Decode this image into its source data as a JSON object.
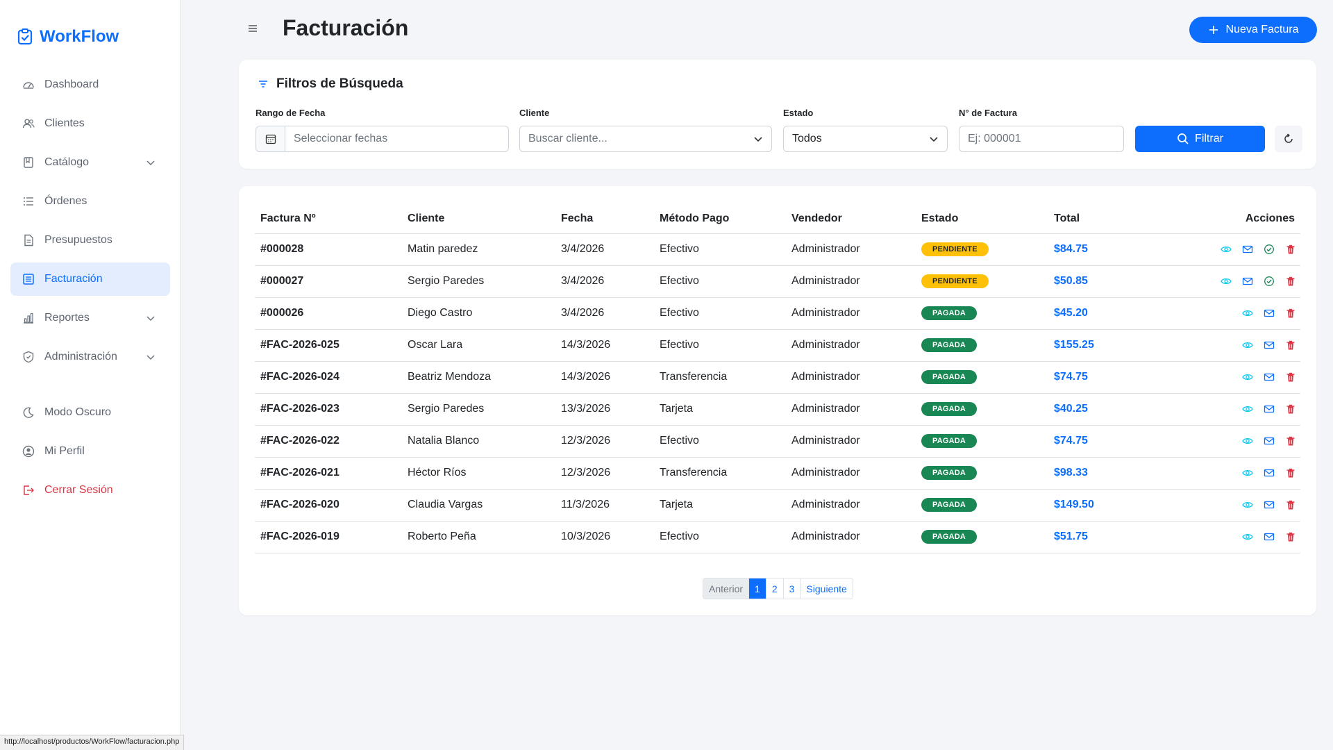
{
  "app": {
    "brand": "WorkFlow",
    "brand_color": "#0d6efd"
  },
  "sidebar": {
    "items": [
      {
        "label": "Dashboard",
        "icon": "dashboard-icon"
      },
      {
        "label": "Clientes",
        "icon": "users-icon"
      },
      {
        "label": "Catálogo",
        "icon": "catalog-icon",
        "has_submenu": true
      },
      {
        "label": "Órdenes",
        "icon": "list-icon"
      },
      {
        "label": "Presupuestos",
        "icon": "document-icon"
      },
      {
        "label": "Facturación",
        "icon": "invoice-icon",
        "active": true
      },
      {
        "label": "Reportes",
        "icon": "chart-icon",
        "has_submenu": true
      },
      {
        "label": "Administración",
        "icon": "shield-icon",
        "has_submenu": true
      }
    ],
    "secondary": [
      {
        "label": "Modo Oscuro",
        "icon": "moon-icon"
      },
      {
        "label": "Mi Perfil",
        "icon": "user-circle-icon"
      },
      {
        "label": "Cerrar Sesión",
        "icon": "logout-icon"
      }
    ]
  },
  "header": {
    "title": "Facturación",
    "new_button": "Nueva Factura"
  },
  "filters": {
    "title": "Filtros de Búsqueda",
    "date_label": "Rango de Fecha",
    "date_placeholder": "Seleccionar fechas",
    "client_label": "Cliente",
    "client_placeholder": "Buscar cliente...",
    "status_label": "Estado",
    "status_value": "Todos",
    "invoice_label": "N° de Factura",
    "invoice_placeholder": "Ej: 000001",
    "filter_button": "Filtrar"
  },
  "table": {
    "columns": [
      "Factura Nº",
      "Cliente",
      "Fecha",
      "Método Pago",
      "Vendedor",
      "Estado",
      "Total",
      "Acciones"
    ],
    "rows": [
      {
        "id": "#000028",
        "client": "Matin paredez",
        "date": "3/4/2026",
        "method": "Efectivo",
        "seller": "Administrador",
        "status": "PENDIENTE",
        "total": "$84.75"
      },
      {
        "id": "#000027",
        "client": "Sergio Paredes",
        "date": "3/4/2026",
        "method": "Efectivo",
        "seller": "Administrador",
        "status": "PENDIENTE",
        "total": "$50.85"
      },
      {
        "id": "#000026",
        "client": "Diego Castro",
        "date": "3/4/2026",
        "method": "Efectivo",
        "seller": "Administrador",
        "status": "PAGADA",
        "total": "$45.20"
      },
      {
        "id": "#FAC-2026-025",
        "client": "Oscar Lara",
        "date": "14/3/2026",
        "method": "Efectivo",
        "seller": "Administrador",
        "status": "PAGADA",
        "total": "$155.25"
      },
      {
        "id": "#FAC-2026-024",
        "client": "Beatriz Mendoza",
        "date": "14/3/2026",
        "method": "Transferencia",
        "seller": "Administrador",
        "status": "PAGADA",
        "total": "$74.75"
      },
      {
        "id": "#FAC-2026-023",
        "client": "Sergio Paredes",
        "date": "13/3/2026",
        "method": "Tarjeta",
        "seller": "Administrador",
        "status": "PAGADA",
        "total": "$40.25"
      },
      {
        "id": "#FAC-2026-022",
        "client": "Natalia Blanco",
        "date": "12/3/2026",
        "method": "Efectivo",
        "seller": "Administrador",
        "status": "PAGADA",
        "total": "$74.75"
      },
      {
        "id": "#FAC-2026-021",
        "client": "Héctor Ríos",
        "date": "12/3/2026",
        "method": "Transferencia",
        "seller": "Administrador",
        "status": "PAGADA",
        "total": "$98.33"
      },
      {
        "id": "#FAC-2026-020",
        "client": "Claudia Vargas",
        "date": "11/3/2026",
        "method": "Tarjeta",
        "seller": "Administrador",
        "status": "PAGADA",
        "total": "$149.50"
      },
      {
        "id": "#FAC-2026-019",
        "client": "Roberto Peña",
        "date": "10/3/2026",
        "method": "Efectivo",
        "seller": "Administrador",
        "status": "PAGADA",
        "total": "$51.75"
      }
    ]
  },
  "pagination": {
    "prev": "Anterior",
    "pages": [
      "1",
      "2",
      "3"
    ],
    "current": "1",
    "next": "Siguiente"
  },
  "status_bar": "http://localhost/productos/WorkFlow/facturacion.php",
  "colors": {
    "pending": "#ffc107",
    "paid": "#198754",
    "danger": "#dc3545",
    "info": "#0dcaf0"
  }
}
